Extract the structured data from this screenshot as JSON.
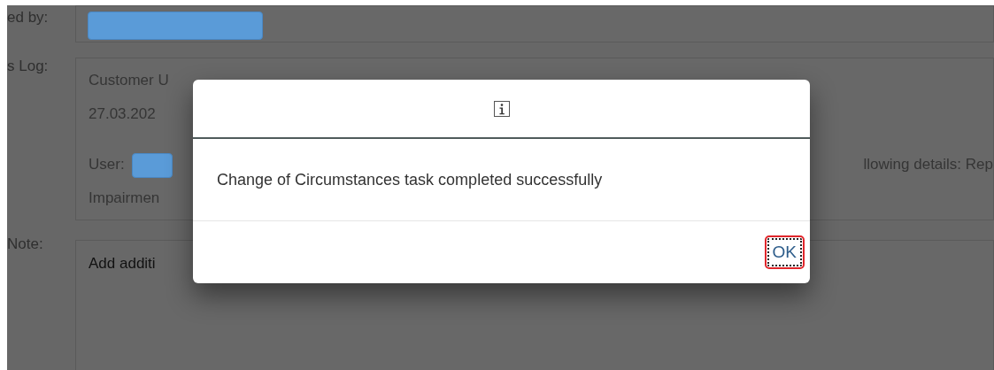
{
  "form": [
    {
      "kind": "field",
      "label": "ed by:",
      "redacted": true
    },
    {
      "kind": "log",
      "label": "s Log:",
      "title": "Customer U",
      "date": "27.03.202",
      "user_label": "User:",
      "user_redacted": true,
      "details_tail": "llowing details: Rep",
      "last_line": "Impairmen"
    },
    {
      "kind": "note",
      "label": "Note:",
      "placeholder": "Add additi"
    }
  ],
  "dialog": {
    "message": "Change of Circumstances task completed successfully",
    "buttons": [
      {
        "label": "OK",
        "focused": true
      }
    ]
  }
}
